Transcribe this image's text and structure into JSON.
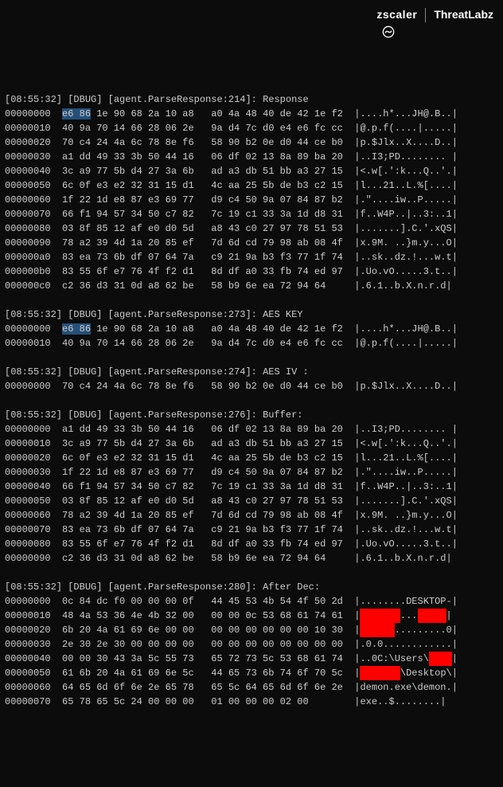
{
  "brand": {
    "left_text": "zscaler",
    "right_bold": "Threat",
    "right_rest": "Labz"
  },
  "blocks": [
    {
      "log": {
        "ts": "[08:55:32]",
        "lvl": "[DBUG]",
        "src": "[agent.ParseResponse:214]",
        "msg": ": Response"
      },
      "rows": [
        {
          "offset": "00000000",
          "bytes_pre": "",
          "hl": "e6 86",
          "bytes_post": " 1e 90 68 2a 10 a8   a0 4a 48 40 de 42 1e f2",
          "ascii": "|....h*...JH@.B..|",
          "redactions": []
        },
        {
          "offset": "00000010",
          "bytes_pre": "40 9a 70 14 66 28 06 2e   9a d4 7c d0 e4 e6 fc cc",
          "hl": "",
          "bytes_post": "",
          "ascii": "|@.p.f(....|.....|",
          "redactions": []
        },
        {
          "offset": "00000020",
          "bytes_pre": "70 c4 24 4a 6c 78 8e f6   58 90 b2 0e d0 44 ce b0",
          "hl": "",
          "bytes_post": "",
          "ascii": "|p.$Jlx..X....D..|",
          "redactions": []
        },
        {
          "offset": "00000030",
          "bytes_pre": "a1 dd 49 33 3b 50 44 16   06 df 02 13 8a 89 ba 20",
          "hl": "",
          "bytes_post": "",
          "ascii": "|..I3;PD........ |",
          "redactions": []
        },
        {
          "offset": "00000040",
          "bytes_pre": "3c a9 77 5b d4 27 3a 6b   ad a3 db 51 bb a3 27 15",
          "hl": "",
          "bytes_post": "",
          "ascii": "|<.w[.':k...Q..'.|",
          "redactions": []
        },
        {
          "offset": "00000050",
          "bytes_pre": "6c 0f e3 e2 32 31 15 d1   4c aa 25 5b de b3 c2 15",
          "hl": "",
          "bytes_post": "",
          "ascii": "|l...21..L.%[....|",
          "redactions": []
        },
        {
          "offset": "00000060",
          "bytes_pre": "1f 22 1d e8 87 e3 69 77   d9 c4 50 9a 07 84 87 b2",
          "hl": "",
          "bytes_post": "",
          "ascii": "|.\"....iw..P.....|",
          "redactions": []
        },
        {
          "offset": "00000070",
          "bytes_pre": "66 f1 94 57 34 50 c7 82   7c 19 c1 33 3a 1d d8 31",
          "hl": "",
          "bytes_post": "",
          "ascii": "|f..W4P..|..3:..1|",
          "redactions": []
        },
        {
          "offset": "00000080",
          "bytes_pre": "03 8f 85 12 af e0 d0 5d   a8 43 c0 27 97 78 51 53",
          "hl": "",
          "bytes_post": "",
          "ascii": "|.......].C.'.xQS|",
          "redactions": []
        },
        {
          "offset": "00000090",
          "bytes_pre": "78 a2 39 4d 1a 20 85 ef   7d 6d cd 79 98 ab 08 4f",
          "hl": "",
          "bytes_post": "",
          "ascii": "|x.9M. ..}m.y...O|",
          "redactions": []
        },
        {
          "offset": "000000a0",
          "bytes_pre": "83 ea 73 6b df 07 64 7a   c9 21 9a b3 f3 77 1f 74",
          "hl": "",
          "bytes_post": "",
          "ascii": "|..sk..dz.!...w.t|",
          "redactions": []
        },
        {
          "offset": "000000b0",
          "bytes_pre": "83 55 6f e7 76 4f f2 d1   8d df a0 33 fb 74 ed 97",
          "hl": "",
          "bytes_post": "",
          "ascii": "|.Uo.vO.....3.t..|",
          "redactions": []
        },
        {
          "offset": "000000c0",
          "bytes_pre": "c2 36 d3 31 0d a8 62 be   58 b9 6e ea 72 94 64",
          "hl": "",
          "bytes_post": "",
          "ascii": "|.6.1..b.X.n.r.d|",
          "redactions": []
        }
      ]
    },
    {
      "log": {
        "ts": "[08:55:32]",
        "lvl": "[DBUG]",
        "src": "[agent.ParseResponse:273]",
        "msg": ": AES KEY"
      },
      "rows": [
        {
          "offset": "00000000",
          "bytes_pre": "",
          "hl": "e6 86",
          "bytes_post": " 1e 90 68 2a 10 a8   a0 4a 48 40 de 42 1e f2",
          "ascii": "|....h*...JH@.B..|",
          "redactions": []
        },
        {
          "offset": "00000010",
          "bytes_pre": "40 9a 70 14 66 28 06 2e   9a d4 7c d0 e4 e6 fc cc",
          "hl": "",
          "bytes_post": "",
          "ascii": "|@.p.f(....|.....|",
          "redactions": []
        }
      ]
    },
    {
      "log": {
        "ts": "[08:55:32]",
        "lvl": "[DBUG]",
        "src": "[agent.ParseResponse:274]",
        "msg": ": AES IV :"
      },
      "rows": [
        {
          "offset": "00000000",
          "bytes_pre": "70 c4 24 4a 6c 78 8e f6   58 90 b2 0e d0 44 ce b0",
          "hl": "",
          "bytes_post": "",
          "ascii": "|p.$Jlx..X....D..|",
          "redactions": []
        }
      ]
    },
    {
      "log": {
        "ts": "[08:55:32]",
        "lvl": "[DBUG]",
        "src": "[agent.ParseResponse:276]",
        "msg": ": Buffer:"
      },
      "rows": [
        {
          "offset": "00000000",
          "bytes_pre": "a1 dd 49 33 3b 50 44 16   06 df 02 13 8a 89 ba 20",
          "hl": "",
          "bytes_post": "",
          "ascii": "|..I3;PD........ |",
          "redactions": []
        },
        {
          "offset": "00000010",
          "bytes_pre": "3c a9 77 5b d4 27 3a 6b   ad a3 db 51 bb a3 27 15",
          "hl": "",
          "bytes_post": "",
          "ascii": "|<.w[.':k...Q..'.|",
          "redactions": []
        },
        {
          "offset": "00000020",
          "bytes_pre": "6c 0f e3 e2 32 31 15 d1   4c aa 25 5b de b3 c2 15",
          "hl": "",
          "bytes_post": "",
          "ascii": "|l...21..L.%[....|",
          "redactions": []
        },
        {
          "offset": "00000030",
          "bytes_pre": "1f 22 1d e8 87 e3 69 77   d9 c4 50 9a 07 84 87 b2",
          "hl": "",
          "bytes_post": "",
          "ascii": "|.\"....iw..P.....|",
          "redactions": []
        },
        {
          "offset": "00000040",
          "bytes_pre": "66 f1 94 57 34 50 c7 82   7c 19 c1 33 3a 1d d8 31",
          "hl": "",
          "bytes_post": "",
          "ascii": "|f..W4P..|..3:..1|",
          "redactions": []
        },
        {
          "offset": "00000050",
          "bytes_pre": "03 8f 85 12 af e0 d0 5d   a8 43 c0 27 97 78 51 53",
          "hl": "",
          "bytes_post": "",
          "ascii": "|.......].C.'.xQS|",
          "redactions": []
        },
        {
          "offset": "00000060",
          "bytes_pre": "78 a2 39 4d 1a 20 85 ef   7d 6d cd 79 98 ab 08 4f",
          "hl": "",
          "bytes_post": "",
          "ascii": "|x.9M. ..}m.y...O|",
          "redactions": []
        },
        {
          "offset": "00000070",
          "bytes_pre": "83 ea 73 6b df 07 64 7a   c9 21 9a b3 f3 77 1f 74",
          "hl": "",
          "bytes_post": "",
          "ascii": "|..sk..dz.!...w.t|",
          "redactions": []
        },
        {
          "offset": "00000080",
          "bytes_pre": "83 55 6f e7 76 4f f2 d1   8d df a0 33 fb 74 ed 97",
          "hl": "",
          "bytes_post": "",
          "ascii": "|.Uo.vO.....3.t..|",
          "redactions": []
        },
        {
          "offset": "00000090",
          "bytes_pre": "c2 36 d3 31 0d a8 62 be   58 b9 6e ea 72 94 64",
          "hl": "",
          "bytes_post": "",
          "ascii": "|.6.1..b.X.n.r.d|",
          "redactions": []
        }
      ]
    },
    {
      "log": {
        "ts": "[08:55:32]",
        "lvl": "[DBUG]",
        "src": "[agent.ParseResponse:280]",
        "msg": ": After Dec:"
      },
      "rows": [
        {
          "offset": "00000000",
          "bytes_pre": "0c 84 dc f0 00 00 00 0f   44 45 53 4b 54 4f 50 2d",
          "hl": "",
          "bytes_post": "",
          "ascii_segments": [
            {
              "t": "|........DESKTOP-|",
              "r": false
            }
          ],
          "redactions": []
        },
        {
          "offset": "00000010",
          "bytes_pre": "48 4a 53 36 4e 4b 32 00   00 00 0c 53 68 61 74 61",
          "hl": "",
          "bytes_post": "",
          "ascii_segments": [
            {
              "t": "|",
              "r": false
            },
            {
              "t": "XXXXXXX",
              "r": true
            },
            {
              "t": "...",
              "r": false
            },
            {
              "t": "XXXXX",
              "r": true
            },
            {
              "t": "|",
              "r": false
            }
          ],
          "redactions": []
        },
        {
          "offset": "00000020",
          "bytes_pre": "6b 20 4a 61 69 6e 00 00   00 00 00 00 00 00 10 30",
          "hl": "",
          "bytes_post": "",
          "ascii_segments": [
            {
              "t": "|",
              "r": false
            },
            {
              "t": "XXXXXX",
              "r": true
            },
            {
              "t": ".........0|",
              "r": false
            }
          ],
          "redactions": []
        },
        {
          "offset": "00000030",
          "bytes_pre": "2e 30 2e 30 00 00 00 00   00 00 00 00 00 00 00 00",
          "hl": "",
          "bytes_post": "",
          "ascii_segments": [
            {
              "t": "|.0.0............|",
              "r": false
            }
          ],
          "redactions": []
        },
        {
          "offset": "00000040",
          "bytes_pre": "00 00 30 43 3a 5c 55 73   65 72 73 5c 53 68 61 74",
          "hl": "",
          "bytes_post": "",
          "ascii_segments": [
            {
              "t": "|..0C:\\Users\\",
              "r": false
            },
            {
              "t": "XXXX",
              "r": true
            },
            {
              "t": "|",
              "r": false
            }
          ],
          "redactions": []
        },
        {
          "offset": "00000050",
          "bytes_pre": "61 6b 20 4a 61 69 6e 5c   44 65 73 6b 74 6f 70 5c",
          "hl": "",
          "bytes_post": "",
          "ascii_segments": [
            {
              "t": "|",
              "r": false
            },
            {
              "t": "XXXXXXX",
              "r": true
            },
            {
              "t": "\\Desktop\\|",
              "r": false
            }
          ],
          "redactions": []
        },
        {
          "offset": "00000060",
          "bytes_pre": "64 65 6d 6f 6e 2e 65 78   65 5c 64 65 6d 6f 6e 2e",
          "hl": "",
          "bytes_post": "",
          "ascii_segments": [
            {
              "t": "|demon.exe\\demon.|",
              "r": false
            }
          ],
          "redactions": []
        },
        {
          "offset": "00000070",
          "bytes_pre": "65 78 65 5c 24 00 00 00   01 00 00 00 02 00",
          "hl": "",
          "bytes_post": "",
          "ascii_segments": [
            {
              "t": "|exe..$........|",
              "r": false
            }
          ],
          "redactions": []
        }
      ]
    }
  ]
}
